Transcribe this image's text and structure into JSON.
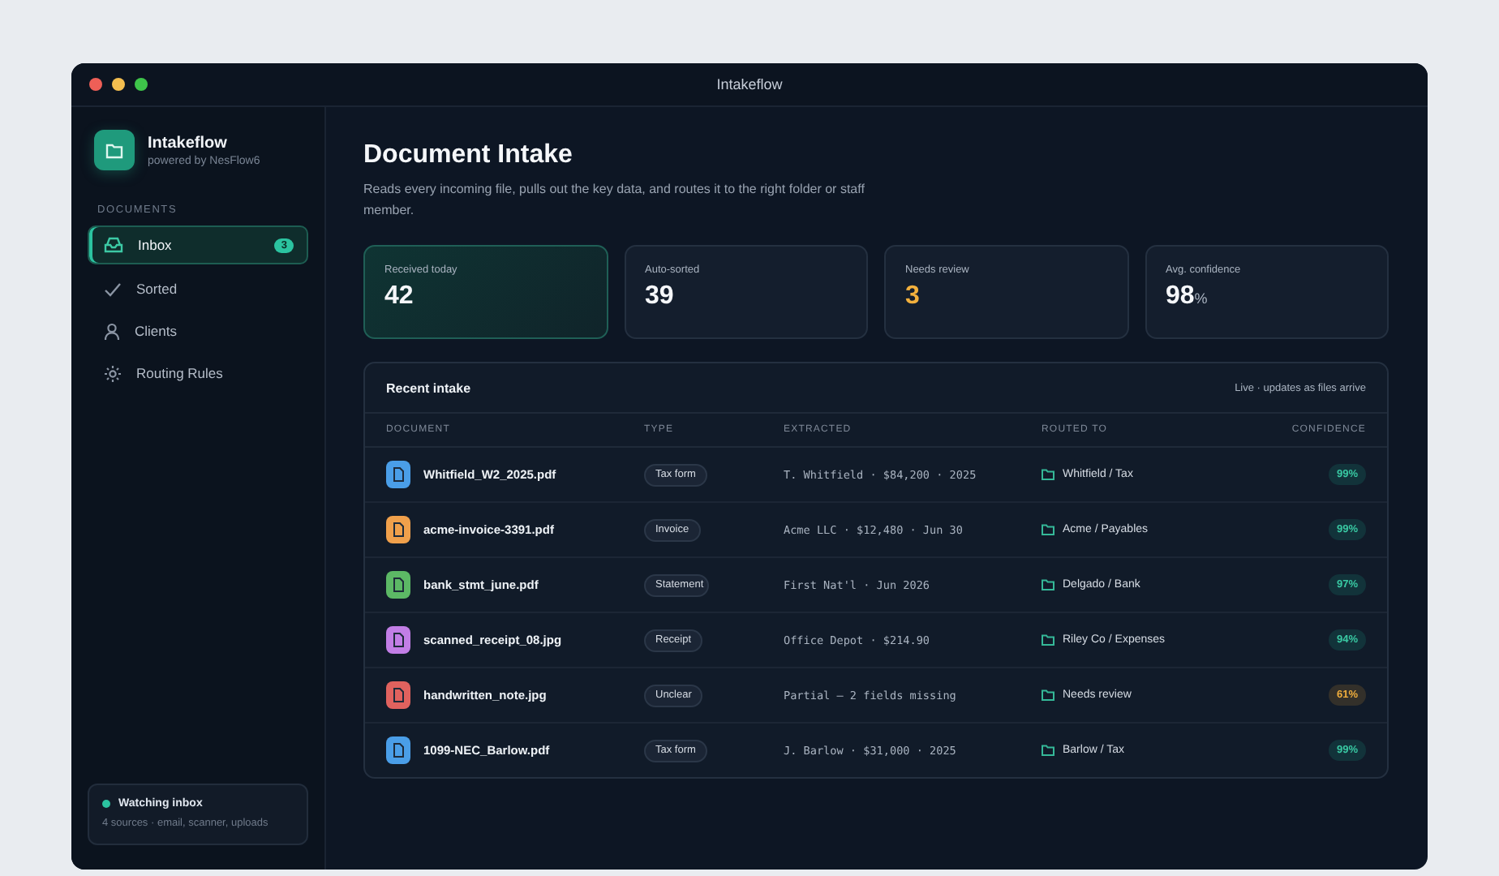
{
  "window": {
    "title": "Intakeflow"
  },
  "brand": {
    "name": "Intakeflow",
    "tagline": "powered by NesFlow6"
  },
  "sidebar": {
    "section": "DOCUMENTS",
    "items": [
      {
        "label": "Inbox",
        "selected": true,
        "badge": "3"
      },
      {
        "label": "Sorted",
        "selected": false
      },
      {
        "label": "Clients",
        "selected": false
      },
      {
        "label": "Routing Rules",
        "selected": false
      }
    ],
    "status": {
      "title": "Watching inbox",
      "detail": "4 sources · email, scanner, uploads",
      "on": true
    }
  },
  "page": {
    "title": "Document Intake",
    "subtitle": "Reads every incoming file, pulls out the key data, and routes it to the right folder or staff member."
  },
  "stats": [
    {
      "label": "Received today",
      "value": "42",
      "selected": true,
      "kind": "normal"
    },
    {
      "label": "Auto-sorted",
      "value": "39",
      "selected": false,
      "kind": "normal"
    },
    {
      "label": "Needs review",
      "value": "3",
      "selected": false,
      "kind": "warn"
    },
    {
      "label": "Avg. confidence",
      "value": "98",
      "unit": "%",
      "selected": false,
      "kind": "normal"
    }
  ],
  "table": {
    "title": "Recent intake",
    "note": "Live · updates as files arrive",
    "columns": [
      "DOCUMENT",
      "TYPE",
      "EXTRACTED",
      "ROUTED TO",
      "CONFIDENCE"
    ],
    "rows": [
      {
        "document": "Whitfield_W2_2025.pdf",
        "color": "#4a9ee8",
        "type": "Tax form",
        "extracted": "T. Whitfield · $84,200 · 2025",
        "routed_to": "Whitfield / Tax",
        "confidence": "99%",
        "kind": "high"
      },
      {
        "document": "acme-invoice-3391.pdf",
        "color": "#f0a04b",
        "type": "Invoice",
        "extracted": "Acme LLC · $12,480 · Jun 30",
        "routed_to": "Acme / Payables",
        "confidence": "99%",
        "kind": "high"
      },
      {
        "document": "bank_stmt_june.pdf",
        "color": "#5cb865",
        "type": "Statement",
        "extracted": "First Nat'l · Jun 2026",
        "routed_to": "Delgado / Bank",
        "confidence": "97%",
        "kind": "high"
      },
      {
        "document": "scanned_receipt_08.jpg",
        "color": "#c27ee6",
        "type": "Receipt",
        "extracted": "Office Depot · $214.90",
        "routed_to": "Riley Co / Expenses",
        "confidence": "94%",
        "kind": "high"
      },
      {
        "document": "handwritten_note.jpg",
        "color": "#e0625e",
        "type": "Unclear",
        "extracted": "Partial — 2 fields missing",
        "routed_to": "Needs review",
        "confidence": "61%",
        "kind": "low"
      },
      {
        "document": "1099-NEC_Barlow.pdf",
        "color": "#4a9ee8",
        "type": "Tax form",
        "extracted": "J. Barlow · $31,000 · 2025",
        "routed_to": "Barlow / Tax",
        "confidence": "99%",
        "kind": "high"
      }
    ]
  }
}
